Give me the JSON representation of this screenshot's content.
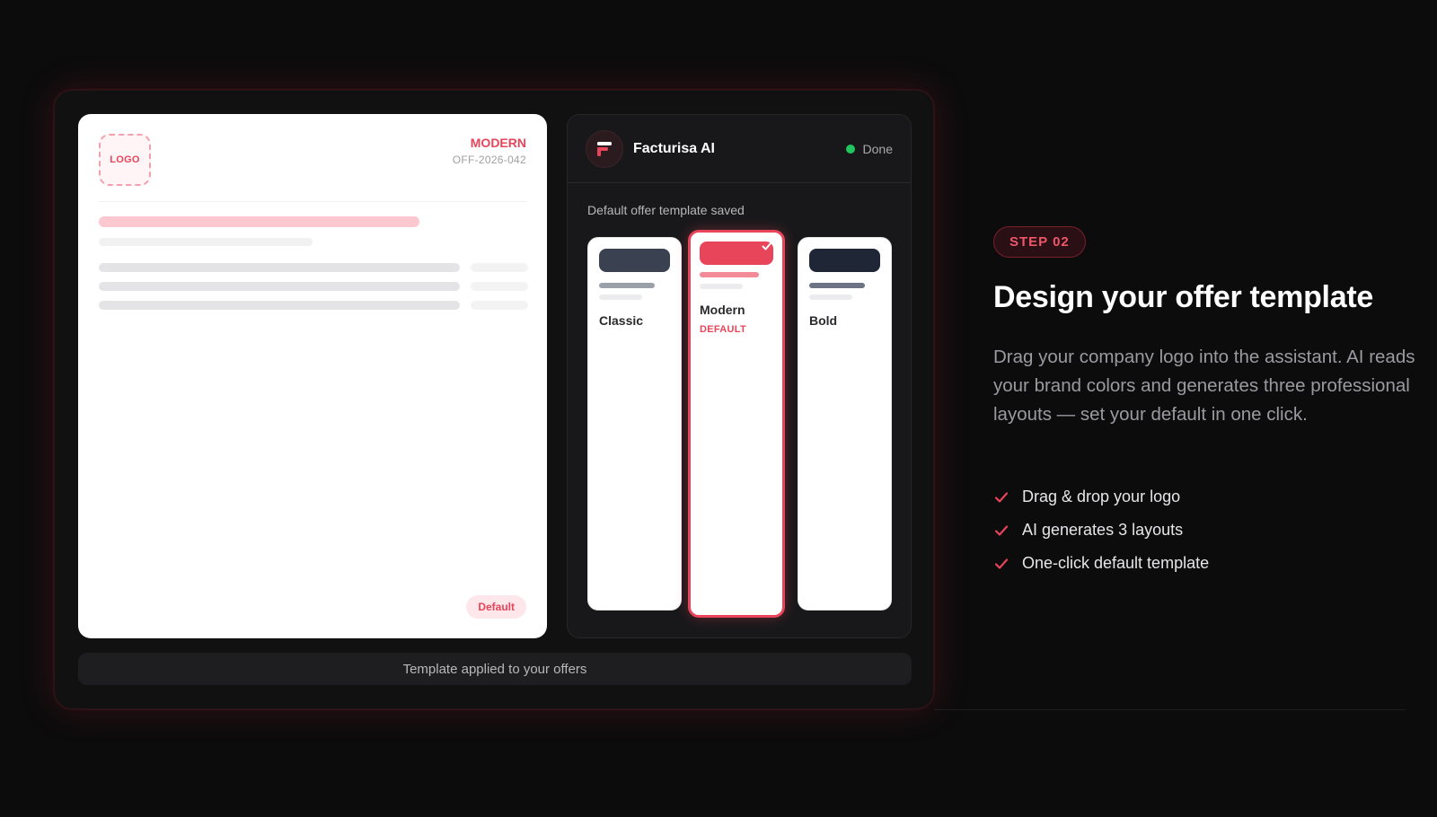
{
  "preview": {
    "logo_label": "LOGO",
    "style_label": "MODERN",
    "offer_number": "OFF-2026-042",
    "badge": "Default"
  },
  "assistant": {
    "name": "Facturisa AI",
    "status": "Done",
    "message": "Default offer template saved",
    "templates": [
      {
        "name": "Classic",
        "header_color": "#3a4150",
        "line_color": "#9aa0aa"
      },
      {
        "name": "Modern",
        "header_color": "#e8445a",
        "line_color": "#f28a98",
        "tag": "DEFAULT",
        "selected": true
      },
      {
        "name": "Bold",
        "header_color": "#1f2636",
        "line_color": "#6b7385"
      }
    ]
  },
  "footer_status": "Template applied to your offers",
  "step": {
    "badge": "STEP 02",
    "title": "Design your offer template",
    "description": "Drag your company logo into the assistant. AI reads your brand colors and generates three professional layouts — set your default in one click.",
    "features": [
      "Drag & drop your logo",
      "AI generates 3 layouts",
      "One-click default template"
    ]
  },
  "colors": {
    "accent": "#e8445a",
    "status_ok": "#22c55e",
    "background": "#0c0c0d"
  }
}
